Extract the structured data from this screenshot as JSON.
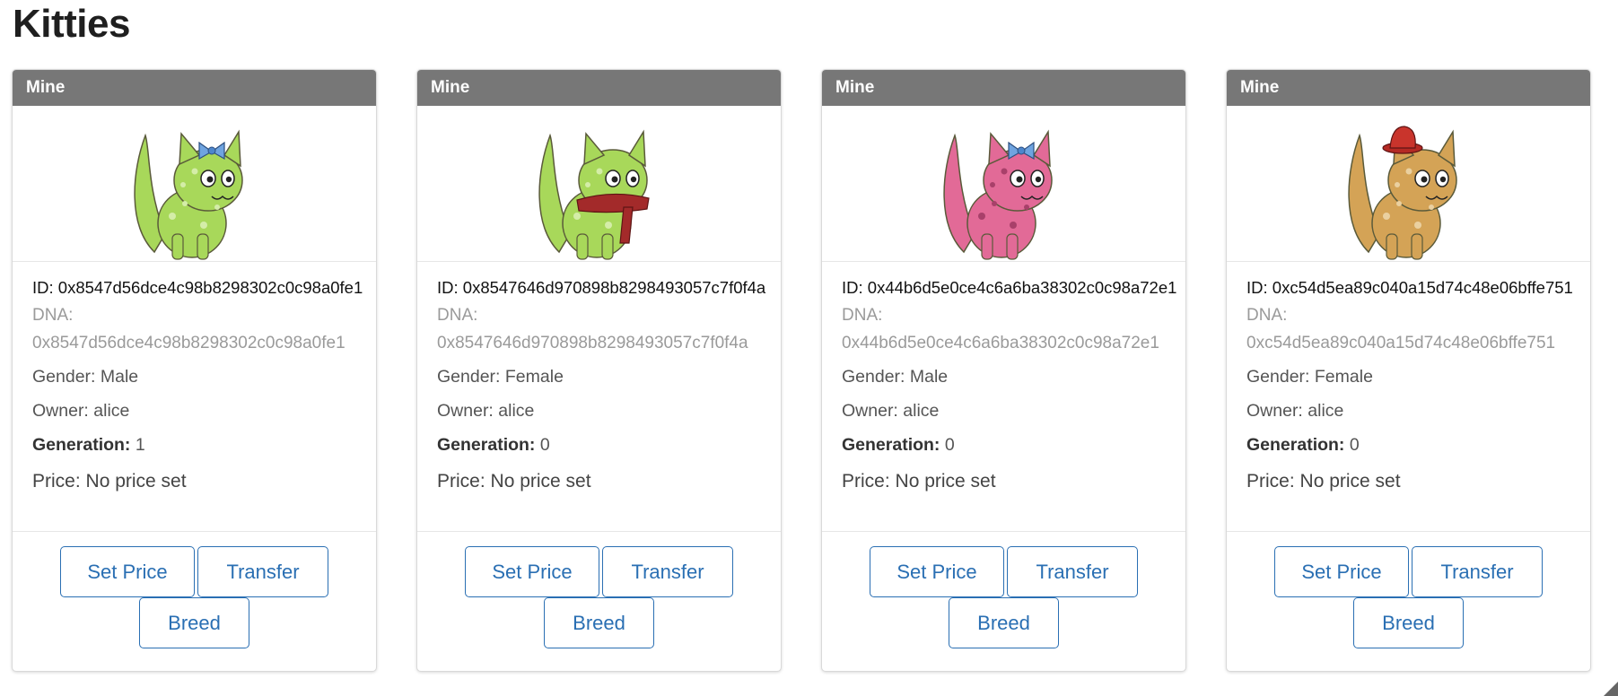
{
  "page": {
    "title": "Kitties"
  },
  "labels": {
    "id_prefix": "ID:",
    "dna": "DNA:",
    "gender": "Gender:",
    "owner": "Owner:",
    "generation": "Generation:",
    "price": "Price:",
    "set_price": "Set Price",
    "transfer": "Transfer",
    "breed": "Breed"
  },
  "kitties": [
    {
      "header": "Mine",
      "id": "0x8547d56dce4c98b8298302c0c98a0fe1",
      "dna": "0x8547d56dce4c98b8298302c0c98a0fe1",
      "gender": "Male",
      "owner": "alice",
      "generation": "1",
      "price": "No price set",
      "color": "#a8d85a",
      "spot_color": "#d4eda8",
      "accessory": "blue-bow"
    },
    {
      "header": "Mine",
      "id": "0x8547646d970898b8298493057c7f0f4a",
      "dna": "0x8547646d970898b8298493057c7f0f4a",
      "gender": "Female",
      "owner": "alice",
      "generation": "0",
      "price": "No price set",
      "color": "#a8d85a",
      "spot_color": "#d4eda8",
      "accessory": "red-scarf"
    },
    {
      "header": "Mine",
      "id": "0x44b6d5e0ce4c6a6ba38302c0c98a72e1",
      "dna": "0x44b6d5e0ce4c6a6ba38302c0c98a72e1",
      "gender": "Male",
      "owner": "alice",
      "generation": "0",
      "price": "No price set",
      "color": "#e26a97",
      "spot_color": "#a8406a",
      "accessory": "blue-bow"
    },
    {
      "header": "Mine",
      "id": "0xc54d5ea89c040a15d74c48e06bffe751",
      "dna": "0xc54d5ea89c040a15d74c48e06bffe751",
      "gender": "Female",
      "owner": "alice",
      "generation": "0",
      "price": "No price set",
      "color": "#d4a356",
      "spot_color": "#ead0a0",
      "accessory": "red-hat"
    }
  ]
}
